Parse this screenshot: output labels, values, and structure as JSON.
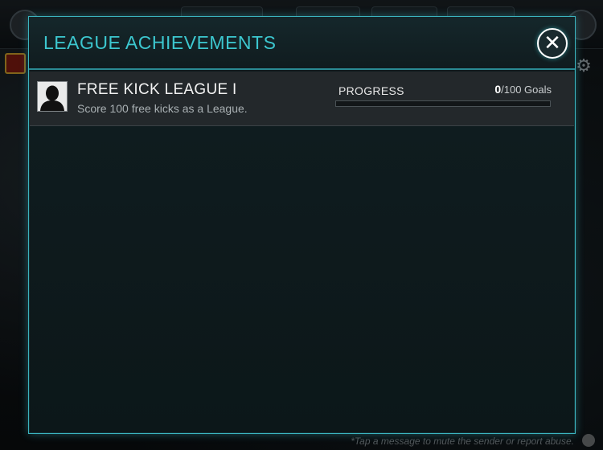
{
  "modal": {
    "title": "LEAGUE ACHIEVEMENTS",
    "close_label": "✕"
  },
  "achievement": {
    "title": "FREE KICK LEAGUE I",
    "description": "Score 100 free kicks as a League.",
    "progress_label": "PROGRESS",
    "progress_current": "0",
    "progress_rest": "/100 Goals",
    "progress_fraction": 0
  },
  "background": {
    "footer_note": "*Tap a message to mute the sender or report abuse."
  },
  "colors": {
    "accent": "#3cc7cf",
    "modal_border": "#3bb4bf",
    "row_bg": "#23282b"
  },
  "icons": {
    "close": "close-icon",
    "avatar": "person-silhouette-icon",
    "settings": "gear-icon"
  }
}
